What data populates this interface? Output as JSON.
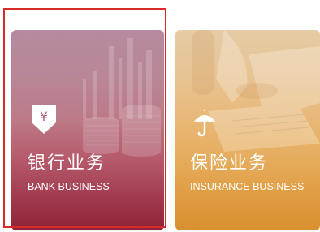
{
  "cards": [
    {
      "id": "bank",
      "title": "银行业务",
      "subtitle": "BANK BUSINESS",
      "icon": "yen-shield-icon",
      "icon_glyph": "¥",
      "selected": true
    },
    {
      "id": "insurance",
      "title": "保险业务",
      "subtitle": "INSURANCE BUSINESS",
      "icon": "umbrella-icon",
      "selected": false
    }
  ],
  "colors": {
    "selection_border": "#d92a2a",
    "bank_gradient_top": "#b58aa0",
    "bank_gradient_bottom": "#8e2236",
    "insurance_gradient_top": "#e6cba5",
    "insurance_gradient_bottom": "#d8902f",
    "text": "#ffffff"
  }
}
